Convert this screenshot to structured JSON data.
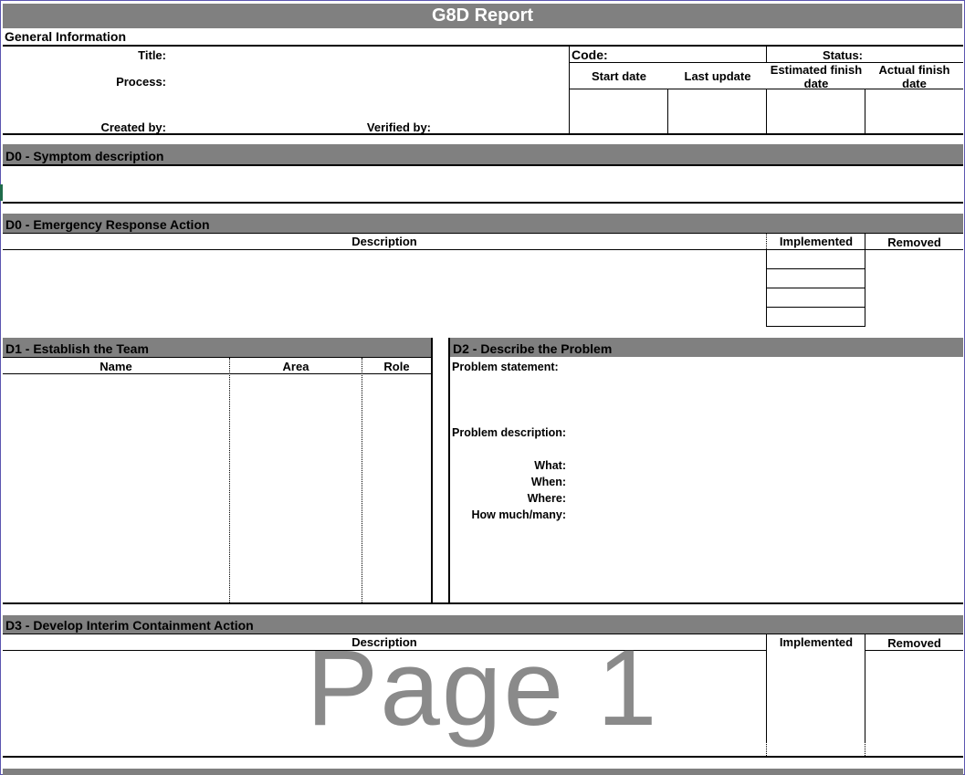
{
  "report": {
    "title": "G8D Report"
  },
  "general": {
    "header": "General Information",
    "title_label": "Title:",
    "process_label": "Process:",
    "created_by_label": "Created by:",
    "verified_by_label": "Verified by:",
    "code_label": "Code:",
    "status_label": "Status:",
    "start_date": "Start date",
    "last_update": "Last update",
    "estimated_finish_line1": "Estimated finish",
    "estimated_finish_line2": "date",
    "actual_finish_line1": "Actual finish",
    "actual_finish_line2": "date"
  },
  "d0_symptom": {
    "header": "D0 - Symptom description"
  },
  "d0_emergency": {
    "header": "D0 - Emergency Response Action",
    "col_description": "Description",
    "col_implemented": "Implemented",
    "col_removed": "Removed"
  },
  "d1": {
    "header": "D1 - Establish the Team",
    "col_name": "Name",
    "col_area": "Area",
    "col_role": "Role"
  },
  "d2": {
    "header": "D2 - Describe the Problem",
    "problem_statement": "Problem statement:",
    "problem_description": "Problem description:",
    "what": "What:",
    "when": "When:",
    "where": "Where:",
    "how_much": "How much/many:"
  },
  "d3": {
    "header": "D3 - Develop Interim Containment Action",
    "col_description": "Description",
    "col_implemented": "Implemented",
    "col_removed": "Removed"
  },
  "watermark": "Page 1",
  "colors": {
    "header_bar": "#808080",
    "frame_border": "#6a5acd"
  }
}
